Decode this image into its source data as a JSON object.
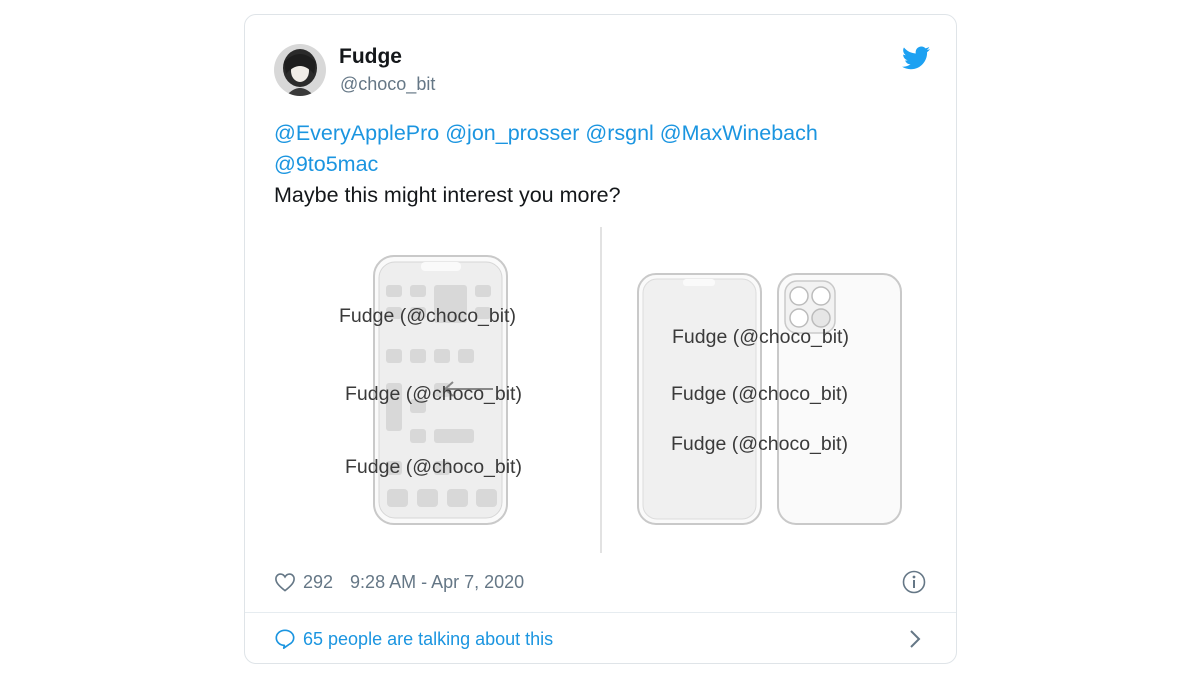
{
  "author": {
    "display_name": "Fudge",
    "handle": "@choco_bit"
  },
  "tweet": {
    "mentions": [
      "@EveryApplePro",
      "@jon_prosser",
      "@rsgnl",
      "@MaxWinebach",
      "@9to5mac"
    ],
    "body": "Maybe this might interest you more?"
  },
  "media": {
    "watermark": "Fudge (@choco_bit)"
  },
  "stats": {
    "likes": "292",
    "timestamp": "9:28 AM - Apr 7, 2020"
  },
  "footer": {
    "talking_label": "65 people are talking about this"
  },
  "icons": {
    "brand": "twitter-bird-icon",
    "like": "heart-icon",
    "info": "info-icon",
    "reply": "speech-bubble-icon",
    "more": "chevron-right-icon"
  },
  "colors": {
    "link": "#1b95e0",
    "text": "#14171a",
    "muted": "#657786"
  }
}
